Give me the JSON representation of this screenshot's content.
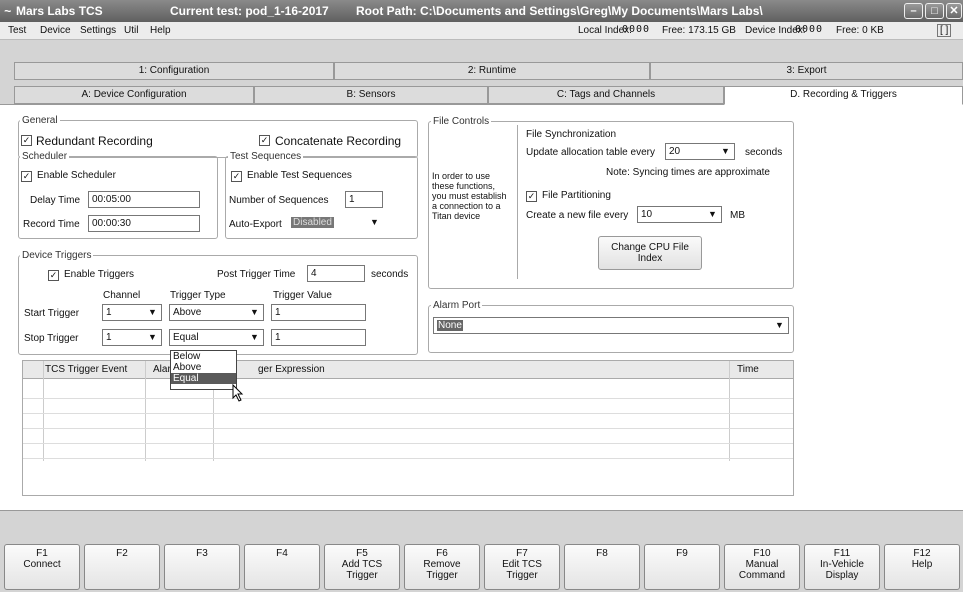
{
  "window": {
    "app_name": "Mars Labs TCS",
    "current_test_label": "Current test: pod_1-16-2017",
    "root_path_label": "Root Path: C:\\Documents and Settings\\Greg\\My Documents\\Mars Labs\\"
  },
  "menu": {
    "items": [
      "Test",
      "Device",
      "Settings",
      "Util",
      "Help"
    ],
    "local_index_label": "Local Index:",
    "local_index_value": "0000",
    "local_free": "Free: 173.15 GB",
    "device_index_label": "Device Index:",
    "device_index_value": "0000",
    "device_free": "Free: 0 KB",
    "bracket": "[ ]"
  },
  "main_tabs": [
    "1: Configuration",
    "2: Runtime",
    "3: Export"
  ],
  "sub_tabs": [
    "A: Device Configuration",
    "B: Sensors",
    "C: Tags and Channels",
    "D. Recording & Triggers"
  ],
  "general": {
    "legend": "General",
    "redundant_recording": "Redundant Recording",
    "concatenate_recording": "Concatenate Recording"
  },
  "scheduler": {
    "legend": "Scheduler",
    "enable": "Enable Scheduler",
    "delay_label": "Delay Time",
    "delay_value": "00:05:00",
    "record_label": "Record Time",
    "record_value": "00:00:30"
  },
  "test_sequences": {
    "legend": "Test Sequences",
    "enable": "Enable Test Sequences",
    "num_label": "Number of Sequences",
    "num_value": "1",
    "auto_export_label": "Auto-Export",
    "auto_export_value": "Disabled"
  },
  "device_triggers": {
    "legend": "Device Triggers",
    "enable": "Enable Triggers",
    "post_label": "Post Trigger Time",
    "post_value": "4",
    "post_unit": "seconds",
    "col_channel": "Channel",
    "col_type": "Trigger Type",
    "col_value": "Trigger Value",
    "start_label": "Start Trigger",
    "start_channel": "1",
    "start_type": "Above",
    "start_value": "1",
    "stop_label": "Stop Trigger",
    "stop_channel": "1",
    "stop_type": "Equal",
    "stop_value": "1",
    "dropdown_options": [
      "Below",
      "Above",
      "Equal"
    ]
  },
  "file_controls": {
    "legend": "File Controls",
    "info_lines": [
      "In order to use",
      "these functions,",
      "you must establish",
      "a connection to a",
      "Titan device"
    ],
    "sync_title": "File Synchronization",
    "update_label": "Update allocation table every",
    "update_value": "20",
    "update_unit": "seconds",
    "note": "Note: Syncing times are approximate",
    "partitioning": "File Partitioning",
    "create_label": "Create a new file every",
    "create_value": "10",
    "create_unit": "MB",
    "change_cpu_line1": "Change CPU File",
    "change_cpu_line2": "Index"
  },
  "alarm_port": {
    "legend": "Alarm Port",
    "value": "None"
  },
  "table": {
    "col1": "TCS Trigger Event",
    "col2": "Alar",
    "col3": "ger Expression",
    "col4": "Time"
  },
  "fkeys": [
    {
      "key": "F1",
      "l1": "Connect",
      "l2": ""
    },
    {
      "key": "F2",
      "l1": "",
      "l2": ""
    },
    {
      "key": "F3",
      "l1": "",
      "l2": ""
    },
    {
      "key": "F4",
      "l1": "",
      "l2": ""
    },
    {
      "key": "F5",
      "l1": "Add TCS",
      "l2": "Trigger"
    },
    {
      "key": "F6",
      "l1": "Remove",
      "l2": "Trigger"
    },
    {
      "key": "F7",
      "l1": "Edit TCS",
      "l2": "Trigger"
    },
    {
      "key": "F8",
      "l1": "",
      "l2": ""
    },
    {
      "key": "F9",
      "l1": "",
      "l2": ""
    },
    {
      "key": "F10",
      "l1": "Manual",
      "l2": "Command"
    },
    {
      "key": "F11",
      "l1": "In-Vehicle",
      "l2": "Display"
    },
    {
      "key": "F12",
      "l1": "Help",
      "l2": ""
    }
  ]
}
